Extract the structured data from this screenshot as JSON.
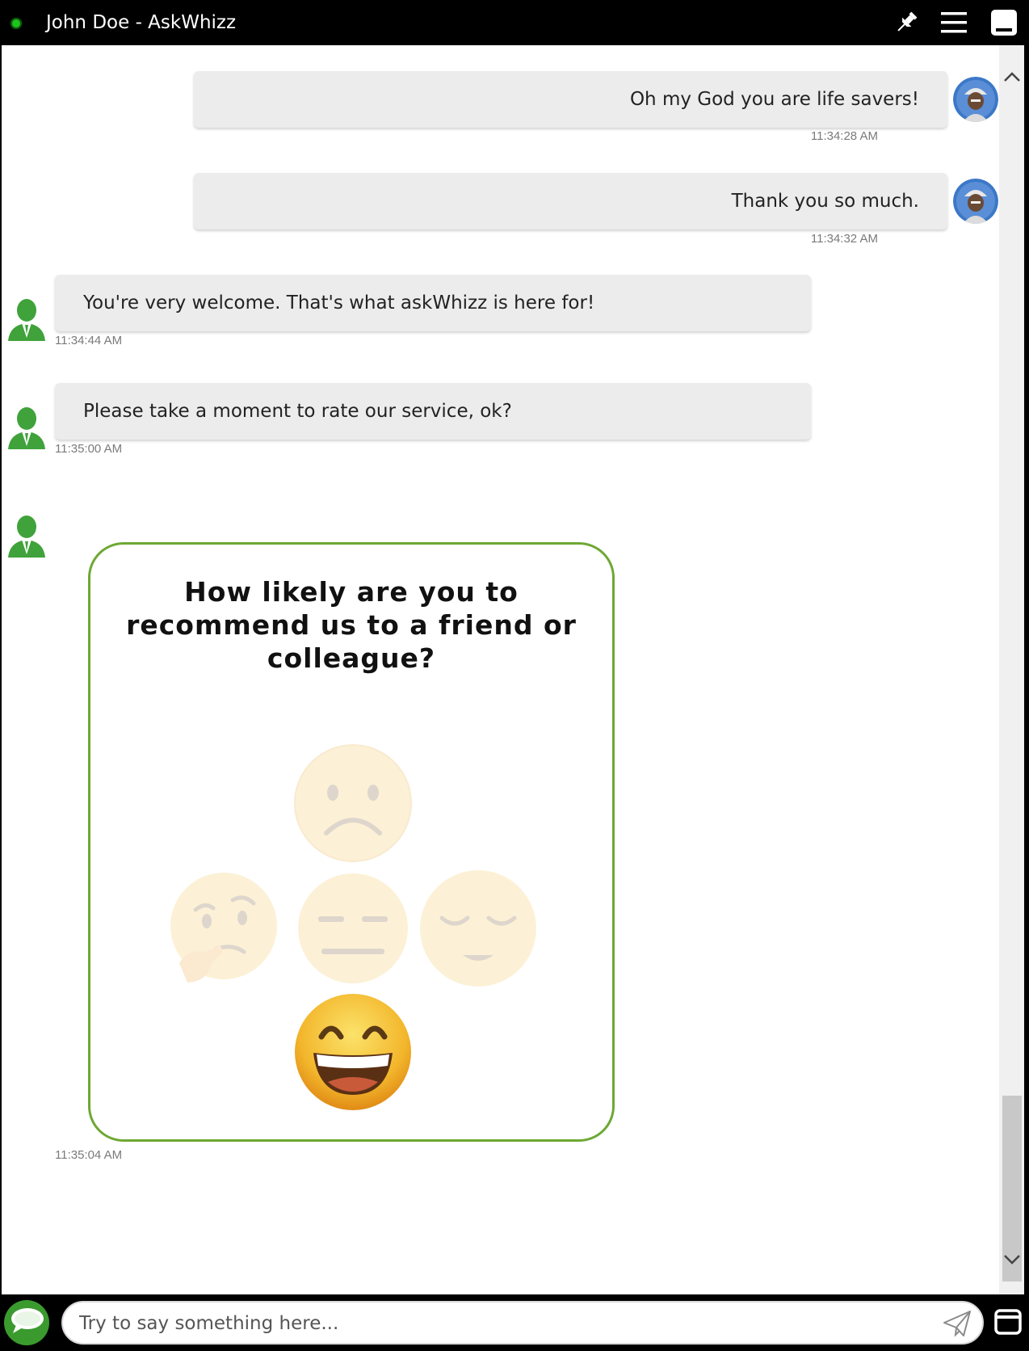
{
  "window": {
    "title": "John Doe - AskWhizz",
    "status_color": "#1ec31e"
  },
  "messages": [
    {
      "sender": "user",
      "text": "Oh my God you are life savers!",
      "time": "11:34:28 AM"
    },
    {
      "sender": "user",
      "text": "Thank you so much.",
      "time": "11:34:32 AM"
    },
    {
      "sender": "agent",
      "text": "You're very welcome. That's what askWhizz is here for!",
      "time": "11:34:44 AM"
    },
    {
      "sender": "agent",
      "text": "Please take a moment to rate our service, ok?",
      "time": "11:35:00 AM"
    }
  ],
  "survey": {
    "question": "How likely are you to recommend us to a friend or colleague?",
    "time": "11:35:04 AM",
    "accent_color": "#6ea834",
    "options": [
      {
        "icon": "sad-face-icon",
        "selected": false
      },
      {
        "icon": "thinking-face-icon",
        "selected": false
      },
      {
        "icon": "neutral-face-icon",
        "selected": false
      },
      {
        "icon": "relieved-face-icon",
        "selected": false
      },
      {
        "icon": "grinning-face-icon",
        "selected": true
      }
    ]
  },
  "input": {
    "placeholder": "Try to say something here...",
    "value": ""
  },
  "icons": {
    "pin": "pin-icon",
    "menu": "menu-icon",
    "minimize": "minimize-icon",
    "send": "send-icon",
    "expand": "expand-icon",
    "logo": "chat-bubble-logo-icon"
  }
}
